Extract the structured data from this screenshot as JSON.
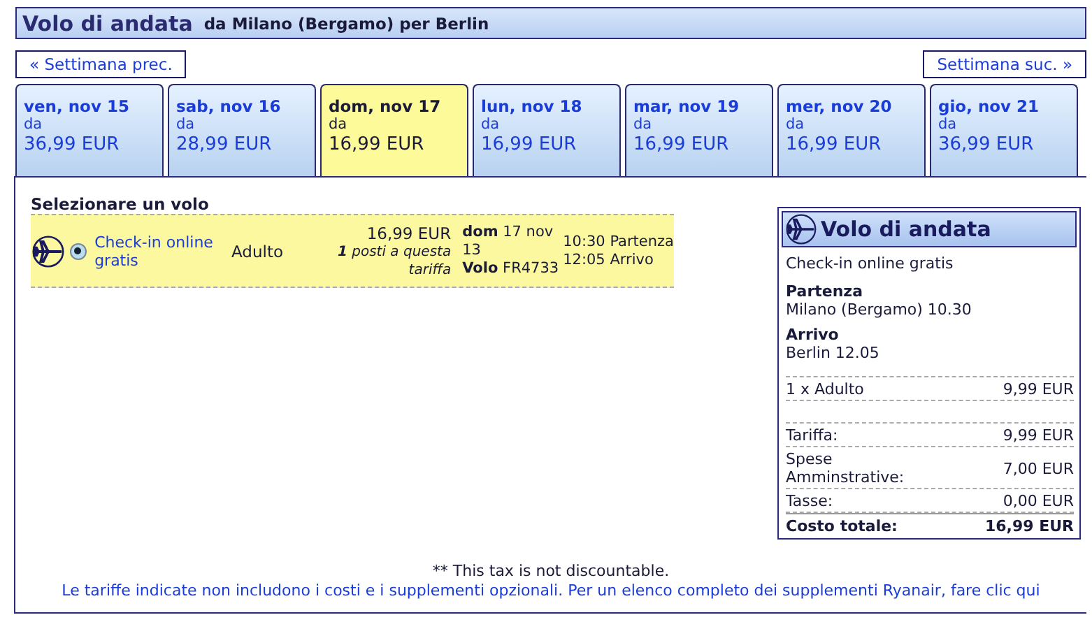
{
  "header": {
    "title": "Volo di andata",
    "route": "da Milano (Bergamo) per Berlin"
  },
  "week_nav": {
    "prev": "« Settimana prec.",
    "next": "Settimana suc. »"
  },
  "day_tabs": [
    {
      "date": "ven, nov 15",
      "from": "da",
      "price": "36,99 EUR",
      "selected": false
    },
    {
      "date": "sab, nov 16",
      "from": "da",
      "price": "28,99 EUR",
      "selected": false
    },
    {
      "date": "dom, nov 17",
      "from": "da",
      "price": "16,99 EUR",
      "selected": true
    },
    {
      "date": "lun, nov 18",
      "from": "da",
      "price": "16,99 EUR",
      "selected": false
    },
    {
      "date": "mar, nov 19",
      "from": "da",
      "price": "16,99 EUR",
      "selected": false
    },
    {
      "date": "mer, nov 20",
      "from": "da",
      "price": "16,99 EUR",
      "selected": false
    },
    {
      "date": "gio, nov 21",
      "from": "da",
      "price": "36,99 EUR",
      "selected": false
    }
  ],
  "flights": {
    "heading": "Selezionare un volo",
    "rows": [
      {
        "selected": true,
        "fare": "Check-in online gratis",
        "passenger": "Adulto",
        "price": "16,99 EUR",
        "seats": "**1** posti a questa tariffa",
        "date": "**dom** 17 nov 13",
        "flight": "**Volo** FR4733",
        "departure": "10:30 Partenza",
        "arrival": "12:05 Arrivo"
      }
    ]
  },
  "summary": {
    "title": "Volo di andata",
    "fare": "Check-in online gratis",
    "departure_label": "Partenza",
    "departure": "Milano (Bergamo) 10.30",
    "arrival_label": "Arrivo",
    "arrival": "Berlin 12.05",
    "passengers": [
      {
        "label": "1 x Adulto",
        "amount": "9,99 EUR"
      }
    ],
    "costs": [
      {
        "label": "Tariffa:",
        "amount": "9,99 EUR"
      },
      {
        "label": "Spese Amminstrative:",
        "amount": "7,00 EUR"
      },
      {
        "label": "Tasse:",
        "amount": "0,00 EUR"
      }
    ],
    "total": {
      "label": "Costo totale:",
      "amount": "16,99 EUR"
    }
  },
  "footer": {
    "note": "** This tax is not discountable.",
    "link": "Le tariffe indicate non includono i costi e i supplementi opzionali. Per un elenco completo dei supplementi Ryanair, fare clic qui"
  }
}
